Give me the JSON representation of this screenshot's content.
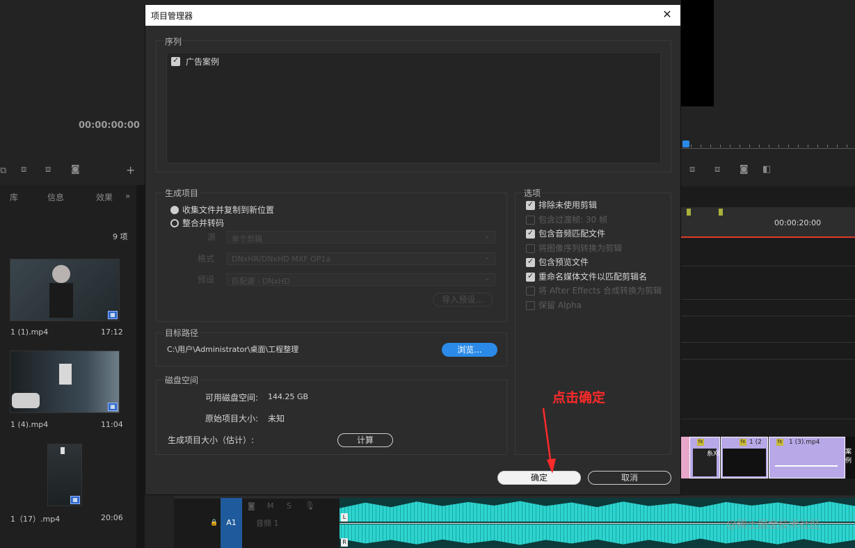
{
  "background": {
    "program_timecode": "00:00:00:00",
    "project_tabs": [
      "库",
      "信息",
      "效果",
      "»"
    ],
    "item_count": "9 项",
    "clips": [
      {
        "name": "1 (1).mp4",
        "duration": "17:12"
      },
      {
        "name": "1 (4).mp4",
        "duration": "11:04"
      },
      {
        "name": "1（17）.mp4",
        "duration": "20:06"
      }
    ],
    "timeline_timecode": "00:00:20:00",
    "track_clips": [
      "糸刈",
      "1 (2",
      "1 (3).mp4",
      "案例"
    ],
    "audio_track": {
      "label": "A1",
      "name": "音频 1",
      "m": "M",
      "s": "S",
      "left": "L",
      "right": "R"
    },
    "watermark": "@稀土掘金技术社区",
    "colors": {
      "accent_blue": "#2b8ae8",
      "waveform": "#2dd4cf",
      "annotation_red": "#ff2a2a"
    }
  },
  "dialog": {
    "title": "项目管理器",
    "close_icon": "close-icon",
    "sequence": {
      "label": "序列",
      "items": [
        {
          "label": "广告案例",
          "checked": true
        }
      ]
    },
    "output": {
      "label": "生成项目",
      "option_collect": "收集文件并复制到新位置",
      "option_consolidate": "整合并转码",
      "source_label": "源",
      "source_value": "单个剪辑",
      "format_label": "格式",
      "format_value": "DNxHR/DNxHD MXF OP1a",
      "preset_label": "预设",
      "preset_value": "匹配源 - DNxHD",
      "import_preset": "导入预设..."
    },
    "options": {
      "label": "选项",
      "items": [
        {
          "label": "排除未使用剪辑",
          "checked": true,
          "enabled": true
        },
        {
          "label": "包含过渡帧: 30 帧",
          "checked": false,
          "enabled": false
        },
        {
          "label": "包含音频匹配文件",
          "checked": true,
          "enabled": true
        },
        {
          "label": "将图像序列转换为剪辑",
          "checked": false,
          "enabled": false
        },
        {
          "label": "包含预览文件",
          "checked": true,
          "enabled": true
        },
        {
          "label": "重命名媒体文件以匹配剪辑名",
          "checked": true,
          "enabled": true
        },
        {
          "label": "将 After Effects 合成转换为剪辑",
          "checked": false,
          "enabled": false
        },
        {
          "label": "保留 Alpha",
          "checked": false,
          "enabled": false
        }
      ]
    },
    "target": {
      "label": "目标路径",
      "path": "C:\\用户\\Administrator\\桌面\\工程整理",
      "browse": "浏览..."
    },
    "disk": {
      "label": "磁盘空间",
      "available_label": "可用磁盘空间:",
      "available_value": "144.25 GB",
      "original_label": "原始项目大小:",
      "original_value": "未知",
      "generated_label": "生成项目大小（估计）:",
      "calculate": "计算"
    },
    "ok": "确定",
    "cancel": "取消"
  },
  "annotation": {
    "text": "点击确定"
  }
}
